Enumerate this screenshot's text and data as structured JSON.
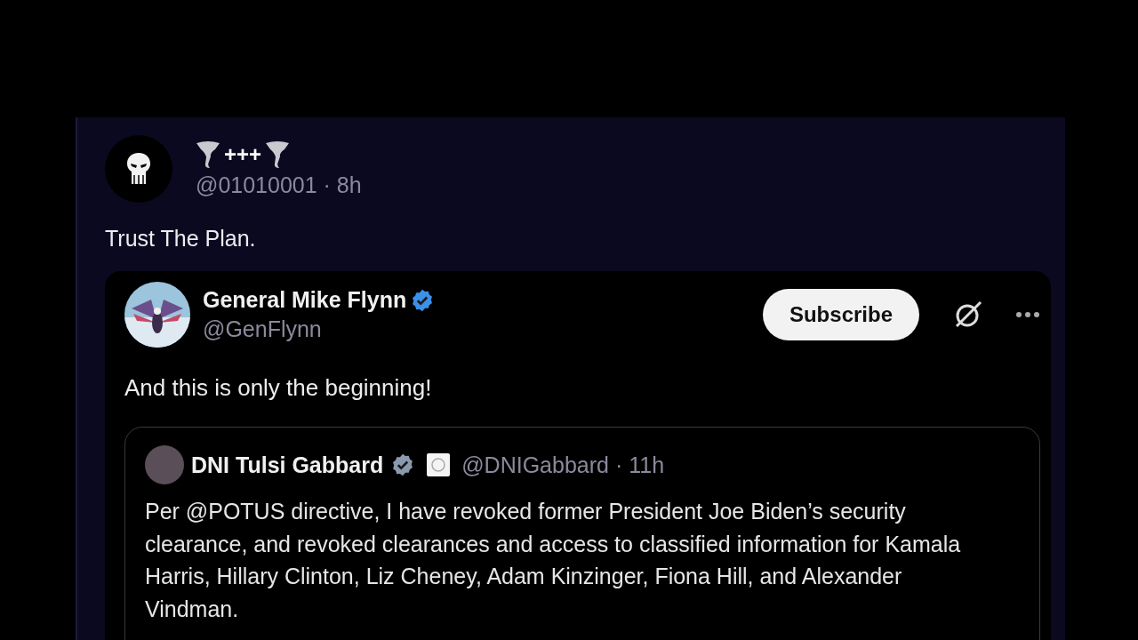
{
  "post": {
    "author": {
      "name": "+++",
      "meta": "@01010001 · 8h"
    },
    "text": "Trust The Plan.",
    "quote": {
      "author": {
        "name": "General Mike Flynn",
        "meta": "@GenFlynn",
        "verified": true,
        "color": "#3b90e8"
      },
      "subscribe_button": "Subscribe",
      "text": "And this is only the beginning!",
      "quote": {
        "author": {
          "name": "DNI Tulsi Gabbard",
          "meta": "@DNIGabbard · 11h",
          "verified": true,
          "color": "#8a9aae"
        },
        "text": "Per @POTUS directive, I have revoked former President Joe Biden’s security clearance, and revoked clearances and access to classified information for Kamala Harris, Hillary Clinton, Liz Cheney, Adam Kinzinger, Fiona Hill, and Alexander Vindman."
      }
    }
  }
}
